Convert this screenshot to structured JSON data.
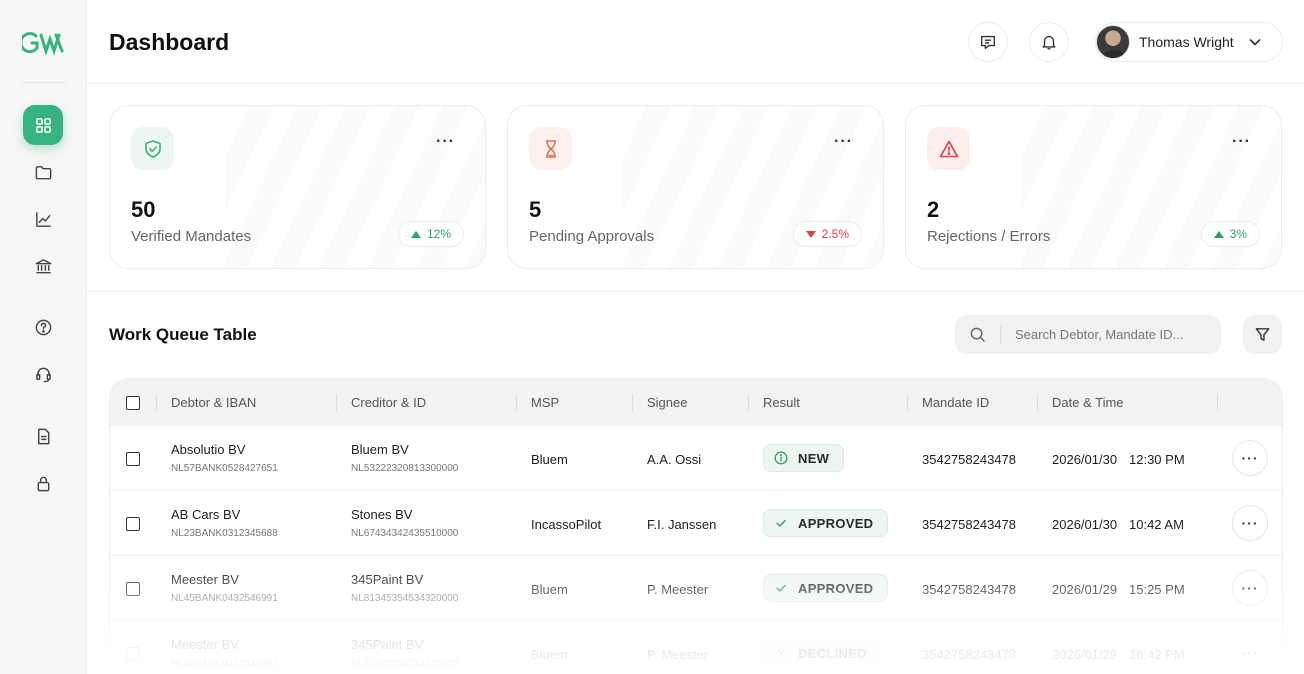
{
  "app": {
    "logo_text": "GW"
  },
  "sidebar": {
    "items": [
      {
        "name": "dashboard",
        "icon": "grid-icon",
        "active": true
      },
      {
        "name": "files",
        "icon": "folder-icon",
        "active": false
      },
      {
        "name": "analytics",
        "icon": "chart-icon",
        "active": false
      },
      {
        "name": "bank",
        "icon": "bank-icon",
        "active": false
      },
      {
        "name": "help",
        "icon": "help-icon",
        "active": false
      },
      {
        "name": "support",
        "icon": "headset-icon",
        "active": false
      },
      {
        "name": "documents",
        "icon": "document-icon",
        "active": false
      },
      {
        "name": "security",
        "icon": "lock-icon",
        "active": false
      }
    ]
  },
  "header": {
    "title": "Dashboard",
    "user_name": "Thomas Wright"
  },
  "stats": [
    {
      "value": "50",
      "label": "Verified Mandates",
      "change": "12%",
      "direction": "up",
      "icon": "shield-check-icon",
      "icon_bg": "#eef6f1",
      "icon_color": "#36b37e"
    },
    {
      "value": "5",
      "label": "Pending Approvals",
      "change": "2.5%",
      "direction": "down",
      "icon": "hourglass-icon",
      "icon_bg": "#fdf1ee",
      "icon_color": "#e0715a"
    },
    {
      "value": "2",
      "label": "Rejections / Errors",
      "change": "3%",
      "direction": "up",
      "icon": "warning-icon",
      "icon_bg": "#fdeeee",
      "icon_color": "#e03e3e"
    }
  ],
  "work_queue": {
    "title": "Work Queue Table",
    "search_placeholder": "Search Debtor, Mandate ID...",
    "columns": [
      "Debtor & IBAN",
      "Creditor & ID",
      "MSP",
      "Signee",
      "Result",
      "Mandate ID",
      "Date & Time"
    ],
    "rows": [
      {
        "debtor": "Absolutio BV",
        "iban": "NL57BANK0528427651",
        "creditor": "Bluem BV",
        "creditor_id": "NL53222320813300000",
        "msp": "Bluem",
        "signee": "A.A. Ossi",
        "result": "NEW",
        "result_icon": "info-icon",
        "mandate_id": "3542758243478",
        "date": "2026/01/30",
        "time": "12:30 PM"
      },
      {
        "debtor": "AB Cars BV",
        "iban": "NL23BANK0312345688",
        "creditor": "Stones BV",
        "creditor_id": "NL67434342435510000",
        "msp": "IncassoPilot",
        "signee": "F.I. Janssen",
        "result": "APPROVED",
        "result_icon": "check-icon",
        "mandate_id": "3542758243478",
        "date": "2026/01/30",
        "time": "10:42 AM"
      },
      {
        "debtor": "Meester BV",
        "iban": "NL45BANK0432546991",
        "creditor": "345Paint BV",
        "creditor_id": "NL81345354534320000",
        "msp": "Bluem",
        "signee": "P. Meester",
        "result": "APPROVED",
        "result_icon": "check-icon",
        "mandate_id": "3542758243478",
        "date": "2026/01/29",
        "time": "15:25 PM"
      },
      {
        "debtor": "Meester BV",
        "iban": "NL45BANK0432546991",
        "creditor": "345Paint BV",
        "creditor_id": "NL81345354534320000",
        "msp": "Bluem",
        "signee": "P. Meester",
        "result": "DECLINED",
        "result_icon": "x-icon",
        "mandate_id": "3542758243478",
        "date": "2026/01/29",
        "time": "16:42 PM"
      }
    ]
  },
  "colors": {
    "accent": "#36b37e",
    "up": "#2e9e6a",
    "down": "#e03e3e"
  }
}
